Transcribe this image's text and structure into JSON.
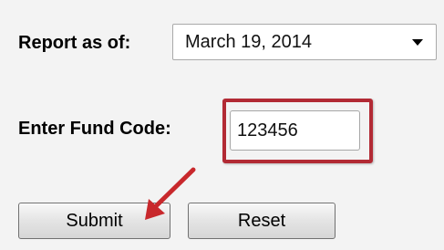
{
  "form": {
    "report_label": "Report as of:",
    "report_date": "March 19, 2014",
    "fund_label": "Enter Fund Code:",
    "fund_code": "123456"
  },
  "buttons": {
    "submit_label": "Submit",
    "reset_label": "Reset"
  },
  "annotations": {
    "highlight_color": "#b22a34",
    "arrow_color": "#c8282c",
    "arrow_target": "submit-button"
  }
}
